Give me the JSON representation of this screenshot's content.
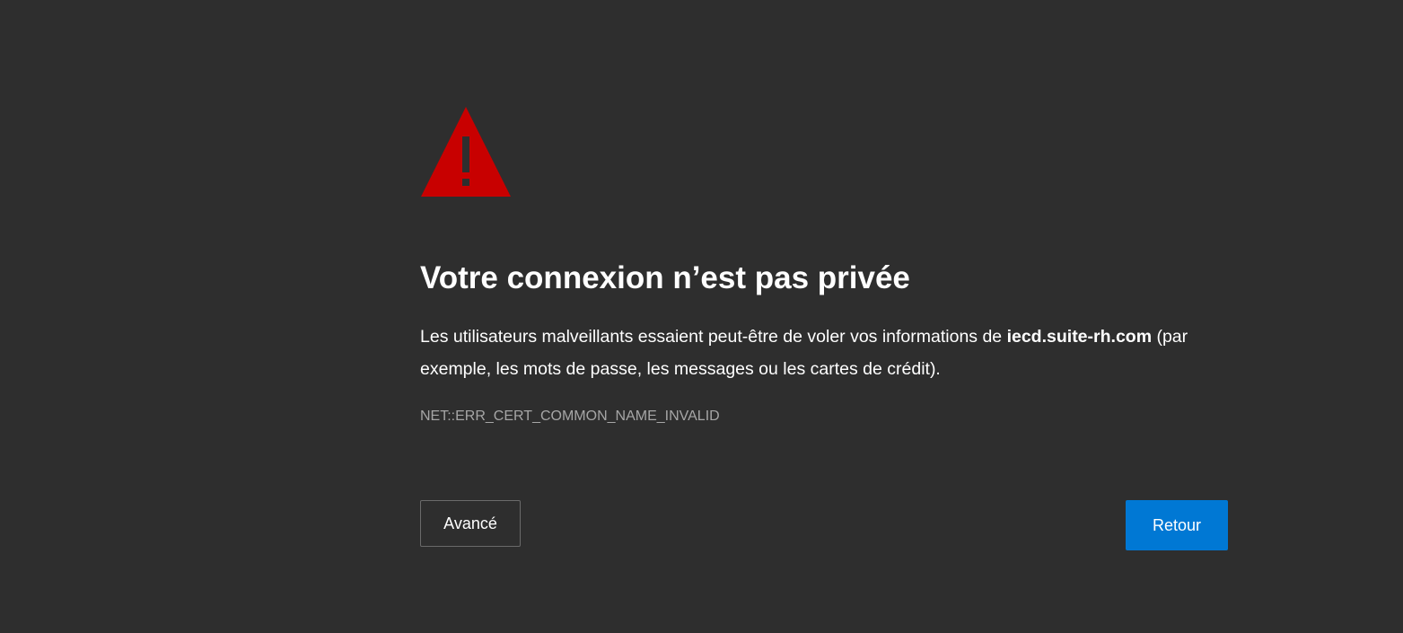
{
  "page": {
    "icon": "warning-triangle-icon",
    "accent_color": "#c80000",
    "title": "Votre connexion n’est pas privée",
    "message_before": "Les utilisateurs malveillants essaient peut-être de voler vos informations de ",
    "host": "iecd.suite-rh.com",
    "message_after": " (par exemple, les mots de passe, les messages ou les cartes de crédit).",
    "error_code": "NET::ERR_CERT_COMMON_NAME_INVALID"
  },
  "buttons": {
    "advanced_label": "Avancé",
    "back_label": "Retour",
    "back_color": "#0078d4"
  }
}
